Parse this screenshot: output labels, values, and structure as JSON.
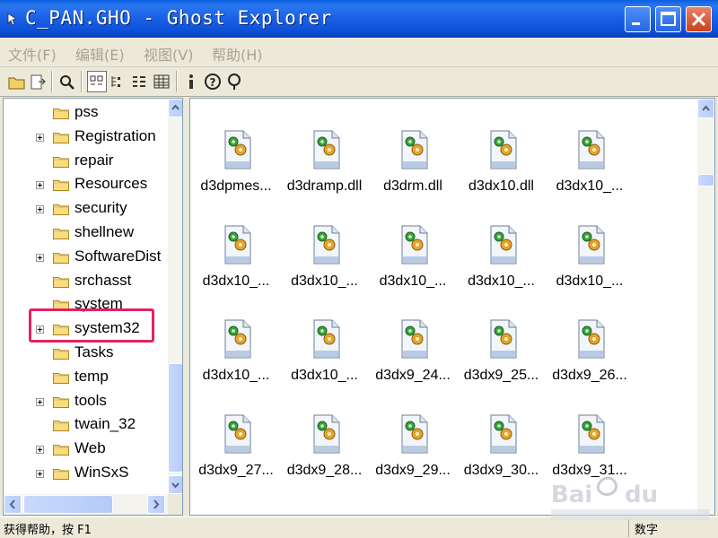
{
  "window": {
    "title": "C_PAN.GHO - Ghost Explorer",
    "controls": {
      "minimize": "minimize-icon",
      "maximize": "maximize-icon",
      "close": "close-icon"
    }
  },
  "menu": [
    "文件(F)",
    "编辑(E)",
    "视图(V)",
    "帮助(H)"
  ],
  "toolbar": {
    "buttons": [
      "open-folder-icon",
      "extract-icon",
      "view-file-icon",
      "large-icons-icon",
      "small-icons-icon",
      "list-view-icon",
      "details-view-icon",
      "properties-icon",
      "help-icon",
      "context-help-icon"
    ],
    "pressed": "large-icons-icon"
  },
  "tree": {
    "items": [
      {
        "label": "pss",
        "expandable": false
      },
      {
        "label": "Registration",
        "expandable": true
      },
      {
        "label": "repair",
        "expandable": false
      },
      {
        "label": "Resources",
        "expandable": true
      },
      {
        "label": "security",
        "expandable": true
      },
      {
        "label": "shellnew",
        "expandable": false
      },
      {
        "label": "SoftwareDist",
        "expandable": true
      },
      {
        "label": "srchasst",
        "expandable": false
      },
      {
        "label": "system",
        "expandable": false
      },
      {
        "label": "system32",
        "expandable": true,
        "highlighted": true
      },
      {
        "label": "Tasks",
        "expandable": false
      },
      {
        "label": "temp",
        "expandable": false
      },
      {
        "label": "tools",
        "expandable": true
      },
      {
        "label": "twain_32",
        "expandable": false
      },
      {
        "label": "Web",
        "expandable": true
      },
      {
        "label": "WinSxS",
        "expandable": true
      }
    ]
  },
  "files": [
    "d3dpmes...",
    "d3dramp.dll",
    "d3drm.dll",
    "d3dx10.dll",
    "d3dx10_...",
    "d3dx10_...",
    "d3dx10_...",
    "d3dx10_...",
    "d3dx10_...",
    "d3dx10_...",
    "d3dx10_...",
    "d3dx10_...",
    "d3dx9_24...",
    "d3dx9_25...",
    "d3dx9_26...",
    "d3dx9_27...",
    "d3dx9_28...",
    "d3dx9_29...",
    "d3dx9_30...",
    "d3dx9_31..."
  ],
  "status": {
    "text": "获得帮助，按 F1",
    "mode": "数字"
  },
  "colors": {
    "title_blue": "#0a5fe0",
    "highlight_border": "#e0245e",
    "menu_disabled": "#a7a398"
  }
}
